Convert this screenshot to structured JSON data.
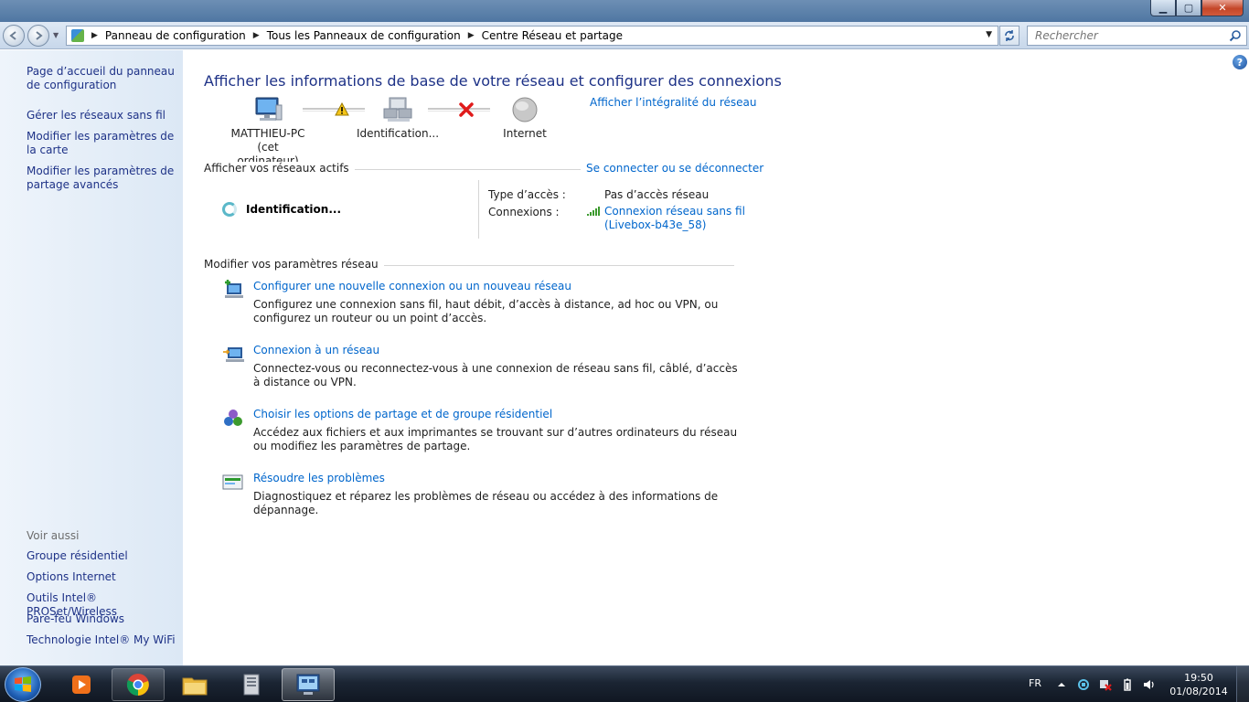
{
  "window": {
    "buttons": {
      "minimize": "▁",
      "maximize": "▢",
      "close": "✕"
    }
  },
  "address": {
    "breadcrumbs": [
      "Panneau de configuration",
      "Tous les Panneaux de configuration",
      "Centre Réseau et partage"
    ],
    "search_placeholder": "Rechercher"
  },
  "sidebar": {
    "top_links": [
      "Page d’accueil du panneau de configuration",
      "Gérer les réseaux sans fil",
      "Modifier les paramètres de la carte",
      "Modifier les paramètres de partage avancés"
    ],
    "see_also_title": "Voir aussi",
    "see_also_links": [
      "Groupe résidentiel",
      "Options Internet",
      "Outils Intel® PROSet/Wireless",
      "Pare-feu Windows",
      "Technologie Intel® My WiFi"
    ]
  },
  "main": {
    "title": "Afficher les informations de base de votre réseau et configurer des connexions",
    "full_map_link": "Afficher l’intégralité du réseau",
    "map": {
      "computer_line1": "MATTHIEU-PC",
      "computer_line2": "(cet ordinateur)",
      "network_label": "Identification...",
      "internet_label": "Internet"
    },
    "active_networks_title": "Afficher vos réseaux actifs",
    "connect_link": "Se connecter ou se déconnecter",
    "active_network_name": "Identification...",
    "access_type_label": "Type d’accès :",
    "access_type_value": "Pas d’accès réseau",
    "connections_label": "Connexions :",
    "connection_link_line1": "Connexion réseau sans fil",
    "connection_link_line2": "(Livebox-b43e_58)",
    "settings_title": "Modifier vos paramètres réseau",
    "tasks": [
      {
        "link": "Configurer une nouvelle connexion ou un nouveau réseau",
        "desc": "Configurez une connexion sans fil, haut débit, d’accès à distance, ad hoc ou VPN, ou configurez un routeur ou un point d’accès."
      },
      {
        "link": "Connexion à un réseau",
        "desc": "Connectez-vous ou reconnectez-vous à une connexion de réseau sans fil, câblé, d’accès à distance ou VPN."
      },
      {
        "link": "Choisir les options de partage et de groupe résidentiel",
        "desc": "Accédez aux fichiers et aux imprimantes se trouvant sur d’autres ordinateurs du réseau ou modifiez les paramètres de partage."
      },
      {
        "link": "Résoudre les problèmes",
        "desc": "Diagnostiquez et réparez les problèmes de réseau ou accédez à des informations de dépannage."
      }
    ]
  },
  "taskbar": {
    "language": "FR",
    "time": "19:50",
    "date": "01/08/2014"
  },
  "colors": {
    "link": "#0066cc",
    "title": "#1e3287",
    "sidebar_bg": "#dce8f5"
  }
}
